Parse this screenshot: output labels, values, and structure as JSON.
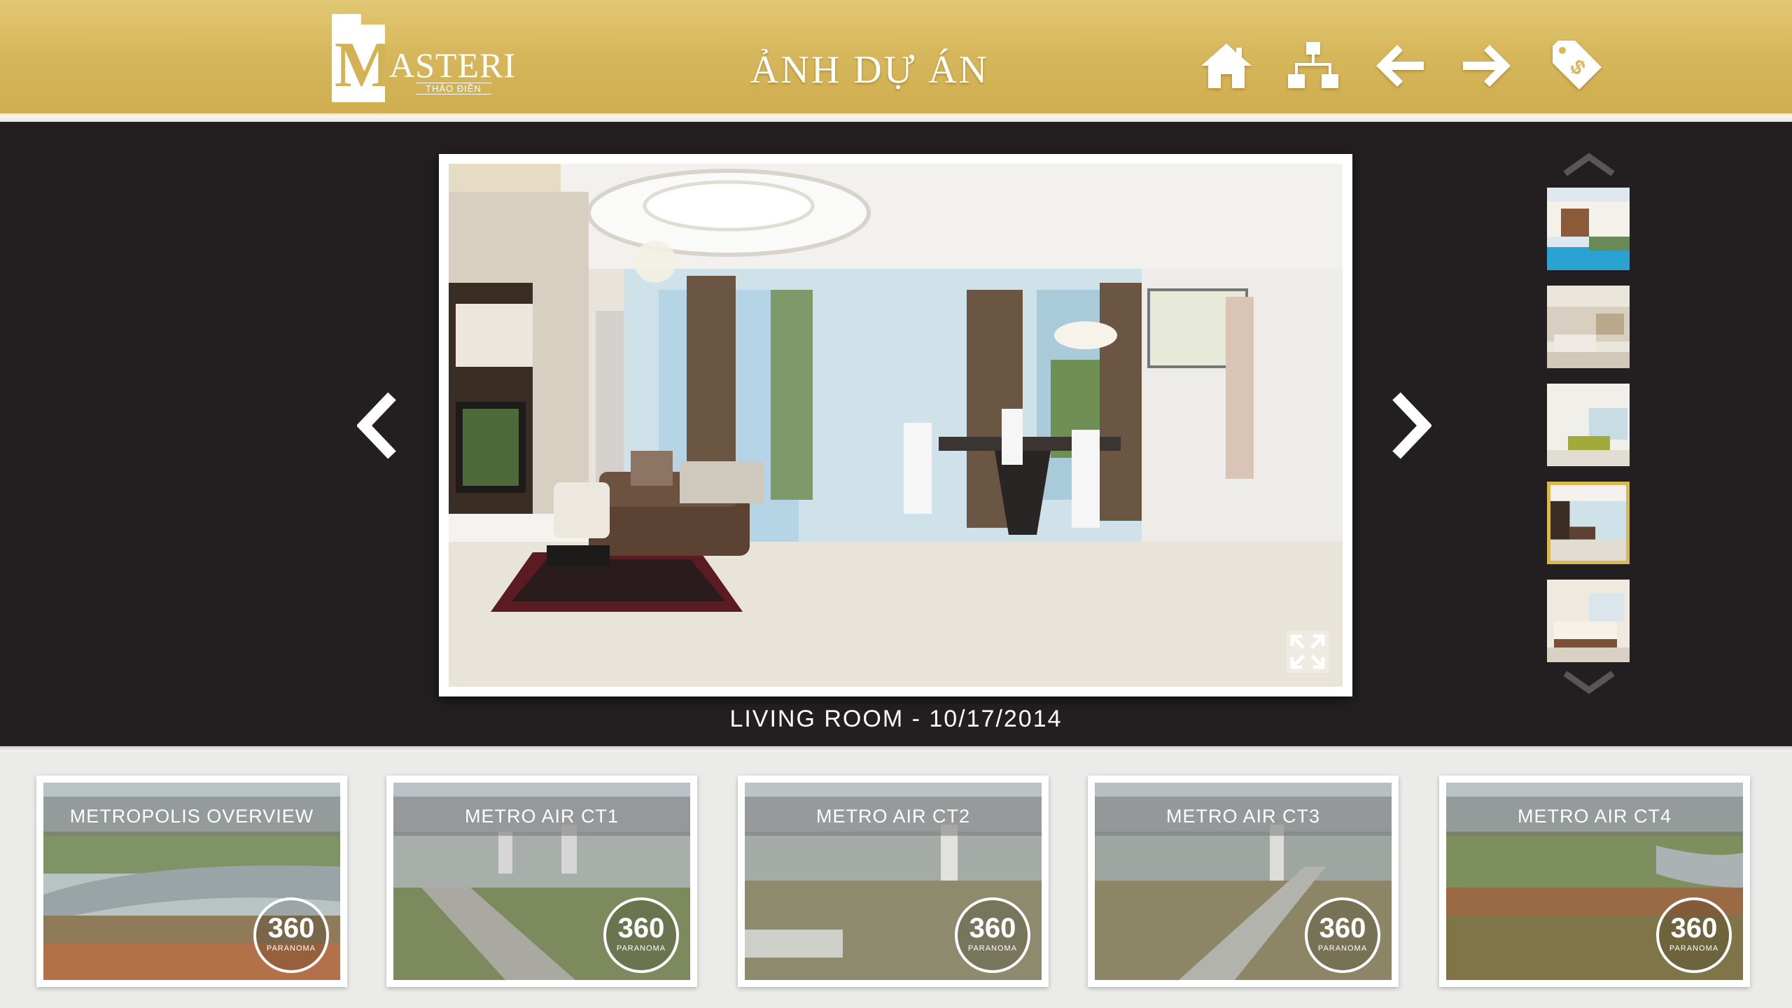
{
  "header": {
    "brand_initial": "M",
    "brand_name": "ASTERI",
    "brand_sub": "THẢO ĐIỀN",
    "title": "ẢNH DỰ ÁN",
    "nav": [
      {
        "icon": "home-icon"
      },
      {
        "icon": "sitemap-icon"
      },
      {
        "icon": "back-arrow-icon"
      },
      {
        "icon": "forward-arrow-icon"
      },
      {
        "icon": "price-tag-icon"
      }
    ]
  },
  "gallery": {
    "caption": "LIVING ROOM - 10/17/2014",
    "selected_thumb_index": 3,
    "thumbs": [
      "pool-terrace",
      "living-room-1",
      "living-room-2",
      "living-room-3",
      "bedroom"
    ]
  },
  "panoramas": [
    {
      "label": "METROPOLIS OVERVIEW",
      "badge": "360",
      "badge_sub": "PARANOMA"
    },
    {
      "label": "METRO AIR CT1",
      "badge": "360",
      "badge_sub": "PARANOMA"
    },
    {
      "label": "METRO AIR CT2",
      "badge": "360",
      "badge_sub": "PARANOMA"
    },
    {
      "label": "METRO AIR CT3",
      "badge": "360",
      "badge_sub": "PARANOMA"
    },
    {
      "label": "METRO AIR CT4",
      "badge": "360",
      "badge_sub": "PARANOMA"
    }
  ],
  "colors": {
    "header_gold": "#d7b75c",
    "stage_bg": "#231f20",
    "selected_border": "#d9b851"
  }
}
